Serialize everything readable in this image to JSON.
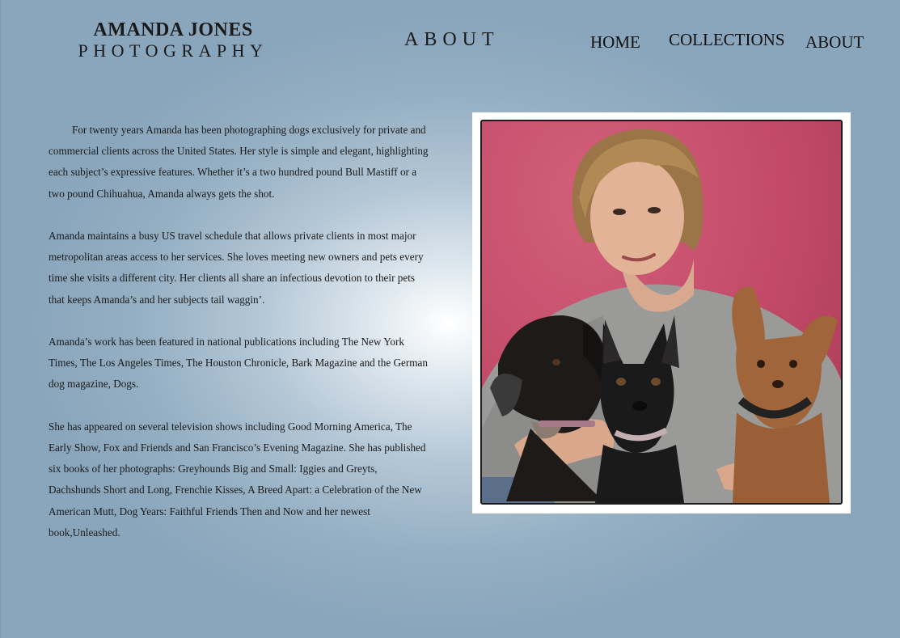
{
  "logo": {
    "name": "AMANDA JONES",
    "subtitle": "PHOTOGRAPHY"
  },
  "page": {
    "heading": "ABOUT"
  },
  "nav": {
    "home": "HOME",
    "collections": "COLLECTIONS",
    "about": "ABOUT"
  },
  "bio": {
    "paragraphs": [
      "For twenty years Amanda has been photographing dogs exclusively for private and commercial clients across the United States. Her style is simple and elegant, highlighting each subject’s expressive features. Whether it’s a two hundred pound Bull Mastiff or a two pound Chihuahua, Amanda always gets the shot.",
      "Amanda maintains a busy US travel schedule that allows private clients in most major metropolitan areas access to her services. She loves meeting new owners and pets every time she visits a different city. Her clients all share an infectious devotion to their pets that keeps Amanda’s and her subjects tail waggin’.",
      "Amanda’s work has been featured in national publications including The New York Times, The Los Angeles Times, The Houston Chronicle, Bark Magazine and the German dog magazine, Dogs.",
      "She has appeared on several television shows including Good Morning America, The Early Show, Fox and Friends and San Francisco’s Evening Magazine. She has published six books of her photographs: Greyhounds Big and Small: Iggies and Greyts, Dachshunds Short and Long, Frenchie Kisses, A Breed Apart: a Celebration of the New American Mutt, Dog Years: Faithful Friends Then and Now and her newest book,Unleashed."
    ]
  },
  "photo": {
    "subject": "portrait-with-three-dogs"
  },
  "colors": {
    "background": "#8aa6bc",
    "backdrop": "#c24a68",
    "text": "#1a1a1a"
  }
}
